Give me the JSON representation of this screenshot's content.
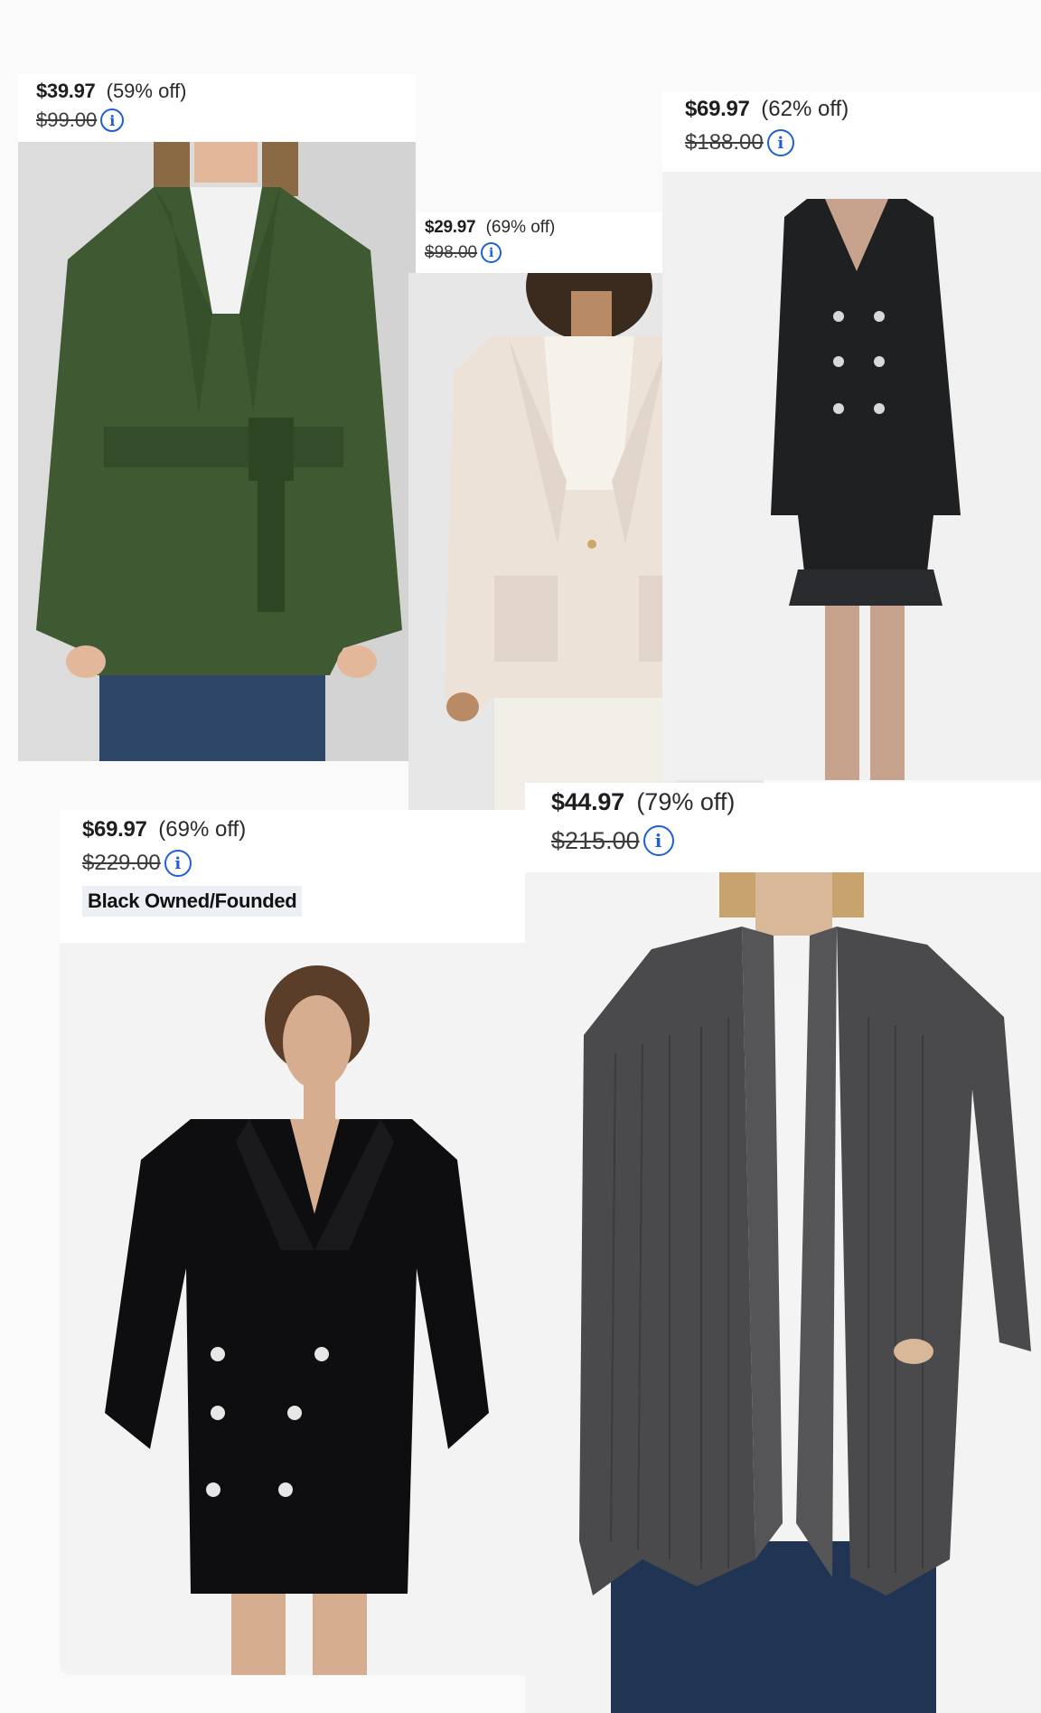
{
  "products": [
    {
      "id": "green-wrap-cardigan",
      "sale_price": "$39.97",
      "discount": "(59% off)",
      "original_price": "$99.00",
      "info_icon": "info-circle-icon"
    },
    {
      "id": "ivory-knit-blazer",
      "sale_price": "$29.97",
      "discount": "(69% off)",
      "original_price": "$98.00",
      "info_icon": "info-circle-icon"
    },
    {
      "id": "black-blazer-dress-ruffle",
      "sale_price": "$69.97",
      "discount": "(62% off)",
      "original_price": "$188.00",
      "info_icon": "info-circle-icon"
    },
    {
      "id": "black-blazer-dress",
      "sale_price": "$69.97",
      "discount": "(69% off)",
      "original_price": "$229.00",
      "badge": "Black Owned/Founded",
      "info_icon": "info-circle-icon"
    },
    {
      "id": "grey-ribbed-cardigan",
      "sale_price": "$44.97",
      "discount": "(79% off)",
      "original_price": "$215.00",
      "info_icon": "info-circle-icon"
    }
  ],
  "colors": {
    "info_blue": "#1f5fd6",
    "badge_bg": "#eceff4",
    "page_bg": "#fafafa"
  }
}
